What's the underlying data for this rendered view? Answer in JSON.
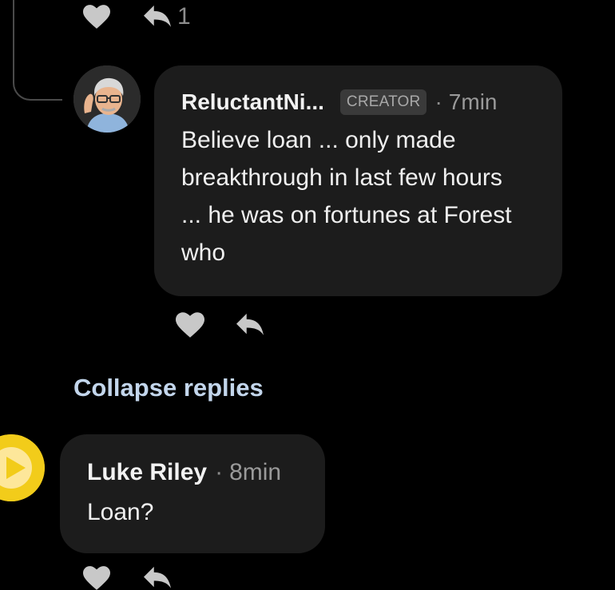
{
  "top_actions": {
    "reply_count": "1"
  },
  "creator_comment": {
    "author": "ReluctantNi...",
    "badge": "CREATOR",
    "separator": "·",
    "time": "7min",
    "text": "Believe loan ... only made breakthrough in last few hours ... he was on fortunes at Forest who"
  },
  "collapse_label": "Collapse replies",
  "luke_comment": {
    "author": "Luke Riley",
    "separator": "·",
    "time": "8min",
    "text": "Loan?"
  },
  "icons": {
    "like": "heart-icon",
    "reply": "reply-arrow-icon",
    "avatar_luke": "play-circle-icon"
  },
  "colors": {
    "background": "#000000",
    "bubble": "#1c1c1c",
    "icon": "#c8c8c8",
    "link": "#c3d6ec",
    "badge_bg": "#3a3a3a",
    "luke_avatar": "#f2cc1a"
  }
}
